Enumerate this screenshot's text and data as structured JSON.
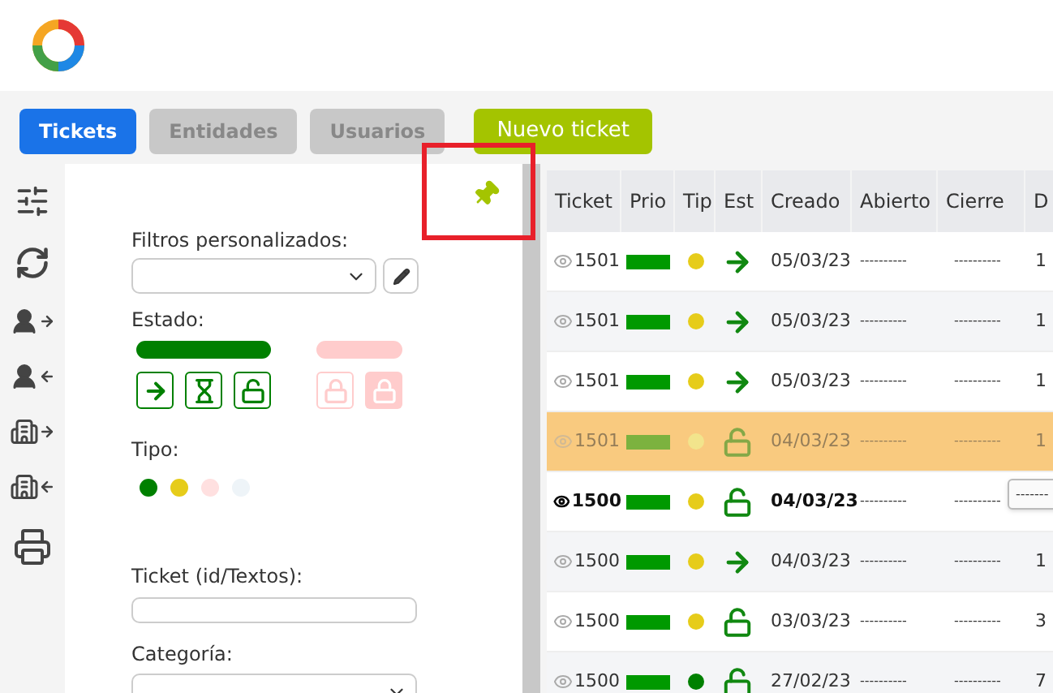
{
  "tabs": [
    {
      "label": "Tickets",
      "selected": true
    },
    {
      "label": "Entidades",
      "selected": false
    },
    {
      "label": "Usuarios",
      "selected": false
    }
  ],
  "new_ticket_button": "Nuevo ticket",
  "filters": {
    "custom_filters_label": "Filtros personalizados:",
    "estado_label": "Estado:",
    "estado_groups": [
      {
        "color": "#008000",
        "states": [
          {
            "kind": "arrow",
            "active": true
          },
          {
            "kind": "hourglass",
            "active": true
          },
          {
            "kind": "unlock",
            "active": true
          }
        ]
      },
      {
        "color": "#ffcccc",
        "states": [
          {
            "kind": "lock",
            "active": false
          },
          {
            "kind": "lock-filled",
            "active": false
          }
        ]
      }
    ],
    "tipo_label": "Tipo:",
    "tipo_dots": [
      {
        "color": "#008000"
      },
      {
        "color": "#e6cc1a"
      },
      {
        "color": "#ffe0e0"
      },
      {
        "color": "#eef4f8"
      }
    ],
    "ticket_label": "Ticket (id/Textos):",
    "categoria_label": "Categoría:"
  },
  "table": {
    "columns": [
      "Ticket",
      "Prio",
      "Tip",
      "Est",
      "Creado",
      "Abierto",
      "Cierre",
      "D"
    ],
    "rows": [
      {
        "ticket": "1501",
        "color": "#e6cc1a",
        "kind": "arrow",
        "creado": "05/03/23",
        "abierto": "----------",
        "cierre": "----------",
        "d": "1",
        "selected": false,
        "unread": false
      },
      {
        "ticket": "1501",
        "color": "#e6cc1a",
        "kind": "arrow",
        "creado": "05/03/23",
        "abierto": "----------",
        "cierre": "----------",
        "d": "1",
        "selected": false,
        "unread": false
      },
      {
        "ticket": "1501",
        "color": "#e6cc1a",
        "kind": "arrow",
        "creado": "05/03/23",
        "abierto": "----------",
        "cierre": "----------",
        "d": "1",
        "selected": false,
        "unread": false
      },
      {
        "ticket": "1501",
        "color": "#f2e48c",
        "kind": "unlock",
        "creado": "04/03/23",
        "abierto": "----------",
        "cierre": "----------",
        "d": "1",
        "selected": true,
        "unread": false
      },
      {
        "ticket": "1500",
        "color": "#e6cc1a",
        "kind": "unlock",
        "creado": "04/03/23",
        "abierto": "----------",
        "cierre": "----------",
        "d": "",
        "selected": false,
        "unread": true
      },
      {
        "ticket": "1500",
        "color": "#e6cc1a",
        "kind": "arrow",
        "creado": "04/03/23",
        "abierto": "----------",
        "cierre": "----------",
        "d": "1",
        "selected": false,
        "unread": false
      },
      {
        "ticket": "1500",
        "color": "#e6cc1a",
        "kind": "unlock",
        "creado": "03/03/23",
        "abierto": "----------",
        "cierre": "----------",
        "d": "3",
        "selected": false,
        "unread": false
      },
      {
        "ticket": "1500",
        "color": "#008000",
        "kind": "unlock",
        "creado": "27/02/23",
        "abierto": "----------",
        "cierre": "----------",
        "d": "7",
        "selected": false,
        "unread": false
      }
    ],
    "tooltip": "-------"
  }
}
